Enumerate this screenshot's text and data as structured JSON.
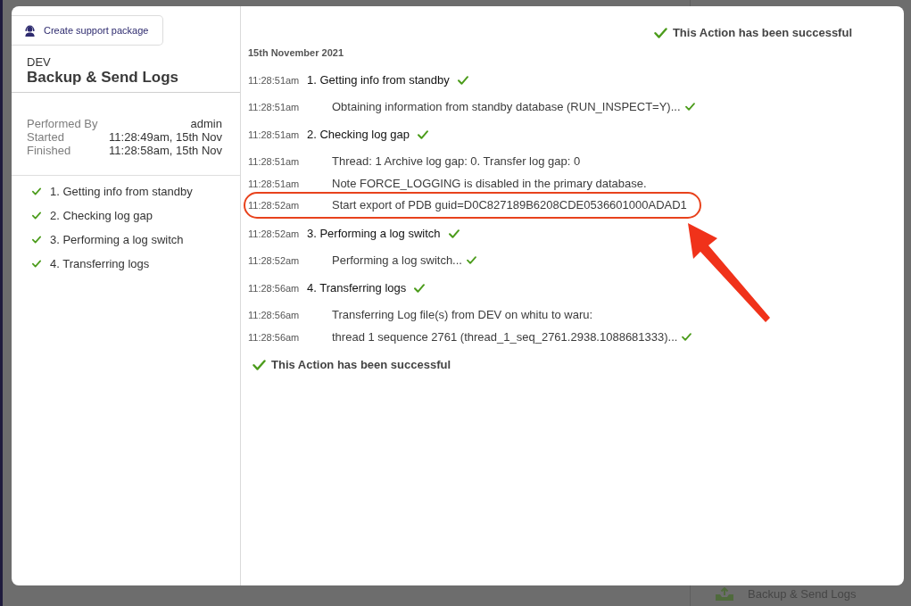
{
  "background": {
    "actions": [
      {
        "kind": "backup",
        "label": "Backup & Send Logs"
      }
    ]
  },
  "modal": {
    "support_button": "Create support package",
    "environment": "DEV",
    "title": "Backup & Send Logs",
    "details": [
      {
        "label": "Performed By",
        "value": "admin"
      },
      {
        "label": "Started",
        "value": "11:28:49am, 15th Nov"
      },
      {
        "label": "Finished",
        "value": "11:28:58am, 15th Nov"
      }
    ],
    "steps": [
      {
        "label": "1. Getting info from standby",
        "done": true
      },
      {
        "label": "2. Checking log gap",
        "done": true
      },
      {
        "label": "3. Performing a log switch",
        "done": true
      },
      {
        "label": "4. Transferring logs",
        "done": true
      }
    ],
    "result_top": "This Action has been successful",
    "log_date": "15th November 2021",
    "log": [
      {
        "kind": "step",
        "time": "11:28:51am",
        "text": "1. Getting info from standby",
        "done": true,
        "highlighted": false
      },
      {
        "kind": "detail",
        "time": "11:28:51am",
        "text": "Obtaining information from standby database (RUN_INSPECT=Y)...",
        "done": true,
        "highlighted": false
      },
      {
        "kind": "step",
        "time": "11:28:51am",
        "text": "2. Checking log gap",
        "done": true,
        "highlighted": false
      },
      {
        "kind": "detail",
        "time": "11:28:51am",
        "text": "Thread: 1 Archive log gap: 0. Transfer log gap: 0",
        "done": false,
        "highlighted": false
      },
      {
        "kind": "detail",
        "time": "11:28:51am",
        "text": "Note FORCE_LOGGING is disabled in the primary database.",
        "done": false,
        "highlighted": false
      },
      {
        "kind": "detail",
        "time": "11:28:52am",
        "text": "Start export of PDB guid=D0C827189B6208CDE0536601000ADAD1",
        "done": false,
        "highlighted": true
      },
      {
        "kind": "step",
        "time": "11:28:52am",
        "text": "3. Performing a log switch",
        "done": true,
        "highlighted": false
      },
      {
        "kind": "detail",
        "time": "11:28:52am",
        "text": "Performing a log switch...",
        "done": true,
        "highlighted": false
      },
      {
        "kind": "step",
        "time": "11:28:56am",
        "text": "4. Transferring logs",
        "done": true,
        "highlighted": false
      },
      {
        "kind": "detail",
        "time": "11:28:56am",
        "text": "Transferring Log file(s) from DEV on whitu to waru:",
        "done": false,
        "highlighted": false
      },
      {
        "kind": "detail",
        "time": "11:28:56am",
        "text": "thread 1 sequence 2761 (thread_1_seq_2761.2938.1088681333)...",
        "done": true,
        "highlighted": false
      }
    ],
    "result_bottom": "This Action has been successful"
  }
}
